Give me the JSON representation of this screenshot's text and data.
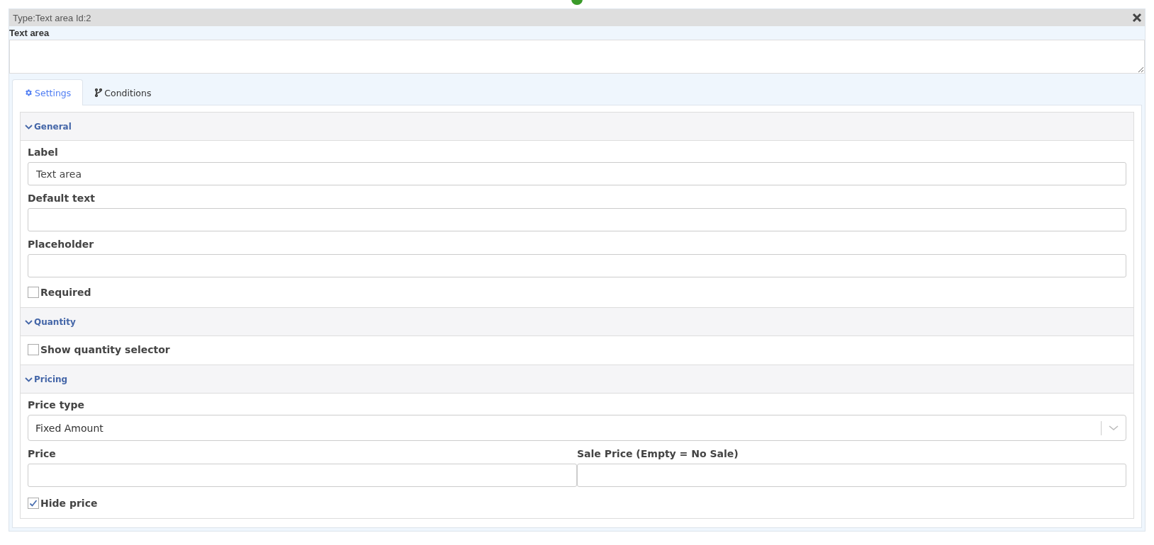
{
  "window": {
    "title": "Type:Text area Id:2"
  },
  "preview": {
    "label": "Text area"
  },
  "tabs": [
    {
      "label": "Settings",
      "selected": true
    },
    {
      "label": "Conditions",
      "selected": false
    }
  ],
  "sections": [
    {
      "title": "General",
      "expanded": true,
      "fields": [
        {
          "kind": "text",
          "label": "Label",
          "value": "Text area"
        },
        {
          "kind": "text",
          "label": "Default text"
        },
        {
          "kind": "text",
          "label": "Placeholder"
        },
        {
          "kind": "checkbox",
          "label": "Required",
          "checked": false
        }
      ]
    },
    {
      "title": "Quantity",
      "expanded": true,
      "fields": [
        {
          "kind": "checkbox",
          "label": "Show quantity selector",
          "checked": false
        }
      ]
    },
    {
      "title": "Pricing",
      "expanded": true,
      "fields": [
        {
          "kind": "select",
          "label": "Price type",
          "value": "Fixed Amount"
        },
        {
          "kind": "pair",
          "items": [
            {
              "label": "Price"
            },
            {
              "label": "Sale Price (Empty = No Sale)"
            }
          ]
        },
        {
          "kind": "checkbox",
          "label": "Hide price",
          "checked": true
        }
      ]
    }
  ]
}
